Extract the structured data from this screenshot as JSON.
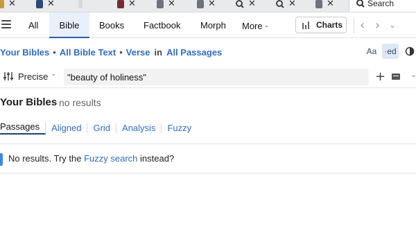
{
  "window_tabs": [
    {
      "icon": "book-icon",
      "color": "#c89a3a"
    },
    {
      "icon": "book-icon",
      "color": "#2e4a7a"
    },
    {
      "icon": "book-icon",
      "color": "#7a2a32"
    },
    {
      "icon": "document-icon",
      "color": "#6c7380"
    },
    {
      "icon": "document-icon",
      "color": "#6c7380"
    },
    {
      "icon": "search-icon",
      "color": "#444444"
    },
    {
      "icon": "search-icon",
      "color": "#444444"
    },
    {
      "icon": "document-icon",
      "color": "#6c7380"
    }
  ],
  "search_tab": {
    "label": "Search"
  },
  "nav": {
    "tabs": [
      "All",
      "Bible",
      "Books",
      "Factbook",
      "Morph",
      "More"
    ],
    "active_tab": "Bible",
    "charts_label": "Charts"
  },
  "breadcrumb": {
    "scope": "Your Bibles",
    "text": "All Bible Text",
    "unit": "Verse",
    "in": "in",
    "passages": "All Passages"
  },
  "format_buttons": {
    "font": "Aa",
    "style": "·ed"
  },
  "query": {
    "mode": "Precise",
    "value": "\"beauty of holiness\""
  },
  "results": {
    "heading": "Your Bibles",
    "count": "no results"
  },
  "view_tabs": [
    "Passages",
    "Aligned",
    "Grid",
    "Analysis",
    "Fuzzy"
  ],
  "message": {
    "prefix": "No results. Try the",
    "link": "Fuzzy search",
    "suffix": "instead?"
  },
  "colors": {
    "accent": "#2f6dc6",
    "active_tab_bg": "#e8f0fb",
    "info_bar": "#3a87e0"
  }
}
